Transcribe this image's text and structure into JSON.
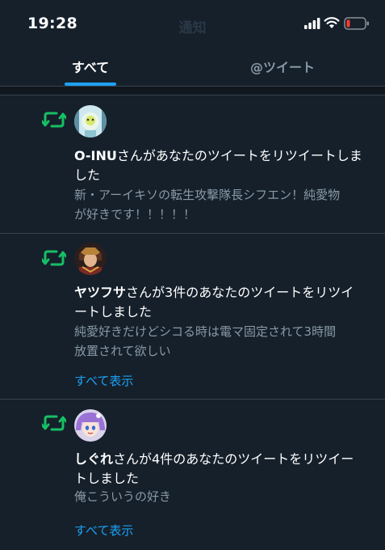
{
  "status_bar": {
    "time": "19:28"
  },
  "header": {
    "title": "通知"
  },
  "tabs": [
    {
      "label": "すべて",
      "selected": true
    },
    {
      "label": "@ツイート",
      "selected": false
    }
  ],
  "notifications": [
    {
      "icon": "retweet-icon",
      "user": "O-INU",
      "action": "さんがあなたのツイートをリツイートしま",
      "action_cont": "した",
      "tweet_line1": "新・アーイキソの転生攻撃隊長シフエン！純愛物",
      "tweet_line2": "が好きです！！！！！"
    },
    {
      "icon": "retweet-icon",
      "user": "ヤツフサ",
      "action": "さんが3件のあなたのツイートをリツイ",
      "action_cont": "ートしました",
      "tweet_line1": "純愛好きだけどシコる時は電マ固定されて3時間",
      "tweet_line2": "放置されて欲しい",
      "show_all": "すべて表示"
    },
    {
      "icon": "retweet-icon",
      "user": "しぐれ",
      "action": "さんが4件のあなたのツイートをリツイー",
      "action_cont": "トしました",
      "tweet_line1": "俺こういうの好き",
      "show_all": "すべて表示"
    }
  ],
  "colors": {
    "background": "#15202b",
    "accent": "#1da1f2",
    "retweet": "#17bf63",
    "secondary_text": "#8899a6",
    "battery_low": "#ff3b30"
  }
}
